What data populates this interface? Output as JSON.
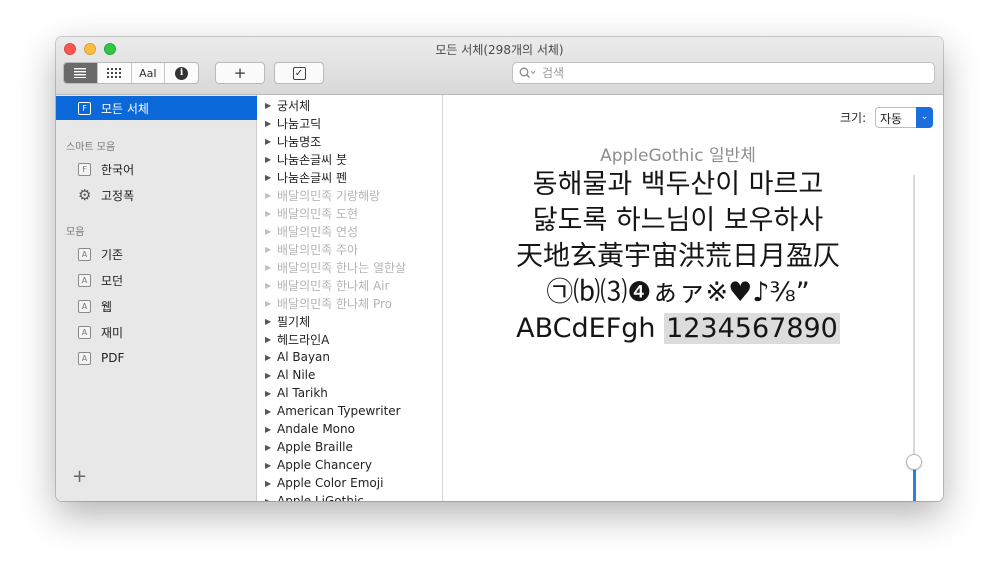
{
  "window": {
    "title": "모든 서체(298개의 서체)"
  },
  "toolbar": {
    "view_buttons": [
      "list-view",
      "grid-view",
      "sample-view",
      "info"
    ],
    "sample_label": "AaI",
    "info_label": "i",
    "add_label": "+",
    "check_label": "✓",
    "search_placeholder": "검색"
  },
  "sidebar": {
    "all_fonts": "모든 서체",
    "smart_header": "스마트 모음",
    "smart_items": [
      "한국어",
      "고정폭"
    ],
    "collections_header": "모음",
    "collections": [
      "기존",
      "모던",
      "웹",
      "재미",
      "PDF"
    ],
    "add_label": "+"
  },
  "font_list": [
    {
      "name": "궁서체",
      "disabled": false
    },
    {
      "name": "나눔고딕",
      "disabled": false
    },
    {
      "name": "나눔명조",
      "disabled": false
    },
    {
      "name": "나눔손글씨 붓",
      "disabled": false
    },
    {
      "name": "나눔손글씨 펜",
      "disabled": false
    },
    {
      "name": "배달의민족 기랑해랑",
      "disabled": true
    },
    {
      "name": "배달의민족 도현",
      "disabled": true
    },
    {
      "name": "배달의민족 연성",
      "disabled": true
    },
    {
      "name": "배달의민족 주아",
      "disabled": true
    },
    {
      "name": "배달의민족 한나는 열한살",
      "disabled": true
    },
    {
      "name": "배달의민족 한나체 Air",
      "disabled": true
    },
    {
      "name": "배달의민족 한나체 Pro",
      "disabled": true
    },
    {
      "name": "필기체",
      "disabled": false
    },
    {
      "name": "헤드라인A",
      "disabled": false
    },
    {
      "name": "Al Bayan",
      "disabled": false
    },
    {
      "name": "Al Nile",
      "disabled": false
    },
    {
      "name": "Al Tarikh",
      "disabled": false
    },
    {
      "name": "American Typewriter",
      "disabled": false
    },
    {
      "name": "Andale Mono",
      "disabled": false
    },
    {
      "name": "Apple Braille",
      "disabled": false
    },
    {
      "name": "Apple Chancery",
      "disabled": false
    },
    {
      "name": "Apple Color Emoji",
      "disabled": false
    },
    {
      "name": "Apple LiGothic",
      "disabled": false
    }
  ],
  "preview": {
    "size_label": "크기:",
    "size_value": "자동",
    "font_name": "AppleGothic 일반체",
    "line1": "동해물과 백두산이 마르고",
    "line2": "닳도록 하느님이 보우하사",
    "line3": "天地玄黃宇宙洪荒日月盈仄",
    "line4": "㉠⒝⑶❹ぁァ※♥♪⅜”",
    "line5_text": "ABCdEFgh",
    "line5_numbers": "1234567890",
    "slider_fraction": 0.17
  },
  "colors": {
    "selection": "#0a68d8",
    "accent": "#1a6fe0"
  }
}
